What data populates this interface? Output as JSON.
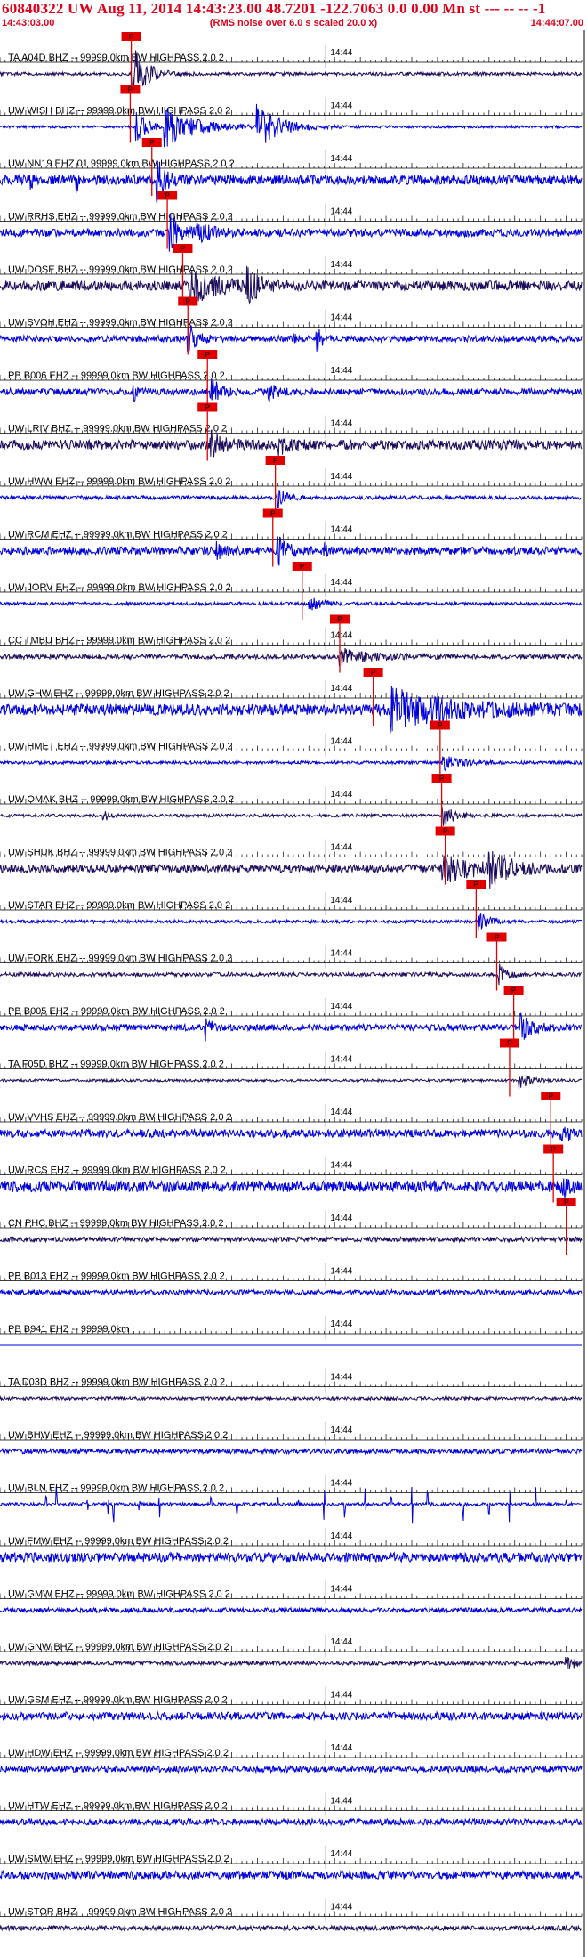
{
  "header": {
    "title": "60840322 UW Aug 11, 2014 14:43:23.00   48.7201 -122.7063  0.0 0.00 Mn st --- -- --  -1",
    "start_time": "14:43:03.00",
    "end_time": "14:44:07.00",
    "note": "(RMS noise over 6.0 s scaled 20.0 x)"
  },
  "chart_data": {
    "type": "line",
    "x_unit": "time",
    "time_window": [
      "14:43:03.00",
      "14:44:07.00"
    ],
    "minute_tick_label": "14:44",
    "pick_label": "P",
    "colors": {
      "blue": "#0000dd",
      "navy": "#1c0a5a",
      "pick": "#e00000",
      "tick": "#000000"
    },
    "traces": [
      {
        "label": "TA A04D BHZ -- 99999.0km BW  HIGHPASS  2.0  2",
        "color": "navy",
        "amp": 0.1,
        "pick_s": 25.5,
        "events": [
          [
            25.8,
            1.8,
            2.5
          ]
        ]
      },
      {
        "label": "UW WISH BHZ -- 99999.0km BW  HIGHPASS  2.0  2",
        "color": "blue",
        "amp": 0.08,
        "pick_s": 25.3,
        "events": [
          [
            26.5,
            1.0,
            2.0
          ],
          [
            32,
            1.3,
            5.5
          ],
          [
            50,
            1.4,
            4.0
          ]
        ]
      },
      {
        "label": "UW NN19 EHZ 01 99999.0km BW  HIGHPASS  2.0  2",
        "color": "blue",
        "amp": 0.3,
        "pick_s": 29.5,
        "events": [
          [
            6,
            0.8,
            0.4
          ],
          [
            30.5,
            1.2,
            1.5
          ],
          [
            15,
            0.6,
            0.4
          ]
        ]
      },
      {
        "label": "UW RRHS EHZ -- 99999.0km BW  HIGHPASS  2.0  2",
        "color": "blue",
        "amp": 0.25,
        "pick_s": 32.5,
        "events": [
          [
            33,
            1.1,
            2.0
          ],
          [
            38,
            0.5,
            3.0
          ]
        ]
      },
      {
        "label": "UW DOSE BHZ -- 99999.0km BW  HIGHPASS  2.0  2",
        "color": "navy",
        "amp": 0.3,
        "pick_s": 35.5,
        "events": [
          [
            37,
            1.1,
            5.0
          ],
          [
            48,
            1.0,
            2.0
          ]
        ]
      },
      {
        "label": "UW SVOH EHZ -- 99999.0km BW  HIGHPASS  2.0  2",
        "color": "blue",
        "amp": 0.2,
        "pick_s": 36.5,
        "events": [
          [
            36.5,
            1.0,
            1.5
          ],
          [
            61.5,
            1.1,
            0.8
          ],
          [
            57,
            0.4,
            0.5
          ]
        ]
      },
      {
        "label": "PB B006 EHZ -- 99999.0km BW  HIGHPASS  2.0  2",
        "color": "blue",
        "amp": 0.2,
        "pick_s": 40.3,
        "events": [
          [
            41,
            0.9,
            1.5
          ],
          [
            26,
            0.5,
            0.8
          ],
          [
            52,
            0.6,
            1.5
          ]
        ]
      },
      {
        "label": "UW LRIV BHZ -- 99999.0km BW  HIGHPASS  2.0  2",
        "color": "navy",
        "amp": 0.3,
        "pick_s": 40.3,
        "events": [
          [
            41,
            0.9,
            2.0
          ],
          [
            54,
            0.5,
            2.0
          ]
        ]
      },
      {
        "label": "UW HWW EHZ -- 99999.0km BW  HIGHPASS  2.0  2",
        "color": "blue",
        "amp": 0.12,
        "pick_s": 53.5,
        "events": [
          [
            54,
            0.6,
            1.5
          ]
        ]
      },
      {
        "label": "UW RCM EHZ -- 99999.0km BW  HIGHPASS  2.0  2",
        "color": "blue",
        "amp": 0.25,
        "pick_s": 53.0,
        "events": [
          [
            54,
            0.8,
            2.0
          ],
          [
            42,
            0.6,
            1.5
          ],
          [
            63,
            0.4,
            0.5
          ]
        ]
      },
      {
        "label": "UW JORV EHZ -- 99999.0km BW  HIGHPASS  2.0  2",
        "color": "blue",
        "amp": 0.1,
        "pick_s": 58.7,
        "events": [
          [
            60,
            0.5,
            2.0
          ]
        ]
      },
      {
        "label": "CC TMBU BHZ -- 99999.0km BW  HIGHPASS  2.0  2",
        "color": "navy",
        "amp": 0.15,
        "pick_s": 66.0,
        "events": [
          [
            66,
            0.5,
            5.0
          ]
        ]
      },
      {
        "label": "UW GHW EHZ -- 99999.0km BW  HIGHPASS  2.0  2",
        "color": "blue",
        "amp": 0.35,
        "pick_s": 72.5,
        "events": [
          [
            76,
            1.2,
            10.0
          ]
        ]
      },
      {
        "label": "UW HMET EHZ -- 99999.0km BW  HIGHPASS  2.0  2",
        "color": "blue",
        "amp": 0.1,
        "pick_s": 85.5,
        "events": [
          [
            86,
            0.5,
            3.0
          ]
        ]
      },
      {
        "label": "UW OMAK BHZ -- 99999.0km BW  HIGHPASS  2.0  2",
        "color": "navy",
        "amp": 0.1,
        "pick_s": 85.8,
        "events": [
          [
            86,
            0.8,
            2.0
          ],
          [
            20,
            0.4,
            1.0
          ]
        ]
      },
      {
        "label": "UW SHUK BHZ -- 99999.0km BW  HIGHPASS  2.0  2",
        "color": "navy",
        "amp": 0.25,
        "pick_s": 86.5,
        "events": [
          [
            86,
            1.0,
            5.0
          ],
          [
            95,
            1.0,
            4.0
          ]
        ]
      },
      {
        "label": "UW STAR EHZ -- 99999.0km BW  HIGHPASS  2.0  2",
        "color": "blue",
        "amp": 0.1,
        "pick_s": 92.5,
        "events": [
          [
            93,
            0.8,
            1.5
          ]
        ]
      },
      {
        "label": "UW FORK EHZ -- 99999.0km BW  HIGHPASS  2.0  2",
        "color": "navy",
        "amp": 0.12,
        "pick_s": 96.5,
        "events": [
          [
            97,
            0.6,
            1.5
          ]
        ]
      },
      {
        "label": "PB B005 EHZ -- 99999.0km BW  HIGHPASS  2.0  2",
        "color": "blue",
        "amp": 0.2,
        "pick_s": 99.8,
        "events": [
          [
            101,
            0.9,
            2.0
          ],
          [
            40,
            0.7,
            1.0
          ]
        ]
      },
      {
        "label": "TA F05D BHZ -- 99999.0km BW  HIGHPASS  2.0  2",
        "color": "navy",
        "amp": 0.08,
        "pick_s": 99.0,
        "events": [
          [
            101,
            0.5,
            2.0
          ]
        ]
      },
      {
        "label": "UW VVHS EHZ -- 99999.0km BW  HIGHPASS  2.0  2",
        "color": "blue",
        "amp": 0.25,
        "pick_s": 107.0,
        "events": [
          [
            109,
            0.9,
            1.0
          ]
        ]
      },
      {
        "label": "UW RCS EHZ -- 99999.0km BW  HIGHPASS  2.0  2",
        "color": "blue",
        "amp": 0.35,
        "pick_s": 107.5,
        "events": [
          [
            109,
            0.9,
            1.0
          ]
        ]
      },
      {
        "label": "CN PHC BHZ -- 99999.0km BW  HIGHPASS  2.0  2",
        "color": "navy",
        "amp": 0.15,
        "pick_s": 110.0,
        "events": []
      },
      {
        "label": "PB B013 EHZ -- 99999.0km BW  HIGHPASS  2.0  2",
        "color": "blue",
        "amp": 0.15,
        "pick_s": null,
        "events": []
      },
      {
        "label": "PB B941 EHZ -- 99999.0km",
        "color": "blue",
        "amp": 0.0,
        "pick_s": null,
        "events": []
      },
      {
        "label": "TA D03D BHZ -- 99999.0km BW  HIGHPASS  2.0  2",
        "color": "navy",
        "amp": 0.1,
        "pick_s": null,
        "events": []
      },
      {
        "label": "UW BHW EHZ -- 99999.0km BW  HIGHPASS  2.0  2",
        "color": "blue",
        "amp": 0.15,
        "pick_s": null,
        "events": []
      },
      {
        "label": "UW BLN EHZ -- 99999.0km BW  HIGHPASS  2.0  2",
        "color": "blue",
        "amp": 0.1,
        "pick_s": null,
        "events": [],
        "spikes": [
          9,
          11,
          17,
          21,
          22,
          27,
          31,
          41,
          46,
          54,
          58,
          63,
          67,
          71,
          76,
          80,
          83,
          90,
          95,
          99,
          104,
          110
        ]
      },
      {
        "label": "UW FMW EHZ -- 99999.0km BW  HIGHPASS  2.0  2",
        "color": "blue",
        "amp": 0.3,
        "pick_s": null,
        "events": []
      },
      {
        "label": "UW GMW EHZ -- 99999.0km BW  HIGHPASS  2.0  2",
        "color": "blue",
        "amp": 0.15,
        "pick_s": null,
        "events": []
      },
      {
        "label": "UW GNW BHZ -- 99999.0km BW  HIGHPASS  2.0  2",
        "color": "navy",
        "amp": 0.12,
        "pick_s": null,
        "events": [
          [
            110,
            0.5,
            2.0
          ]
        ]
      },
      {
        "label": "UW GSM EHZ -- 99999.0km BW  HIGHPASS  2.0  2",
        "color": "blue",
        "amp": 0.25,
        "pick_s": null,
        "events": []
      },
      {
        "label": "UW HDW EHZ -- 99999.0km BW  HIGHPASS  2.0  2",
        "color": "blue",
        "amp": 0.2,
        "pick_s": null,
        "events": []
      },
      {
        "label": "UW HTW EHZ -- 99999.0km BW  HIGHPASS  2.0  2",
        "color": "blue",
        "amp": 0.2,
        "pick_s": null,
        "events": []
      },
      {
        "label": "UW SMW EHZ -- 99999.0km BW  HIGHPASS  2.0  2",
        "color": "blue",
        "amp": 0.25,
        "pick_s": null,
        "events": []
      },
      {
        "label": "UW STOR BHZ -- 99999.0km BW  HIGHPASS  2.0  2",
        "color": "navy",
        "amp": 0.15,
        "pick_s": null,
        "events": []
      }
    ]
  }
}
